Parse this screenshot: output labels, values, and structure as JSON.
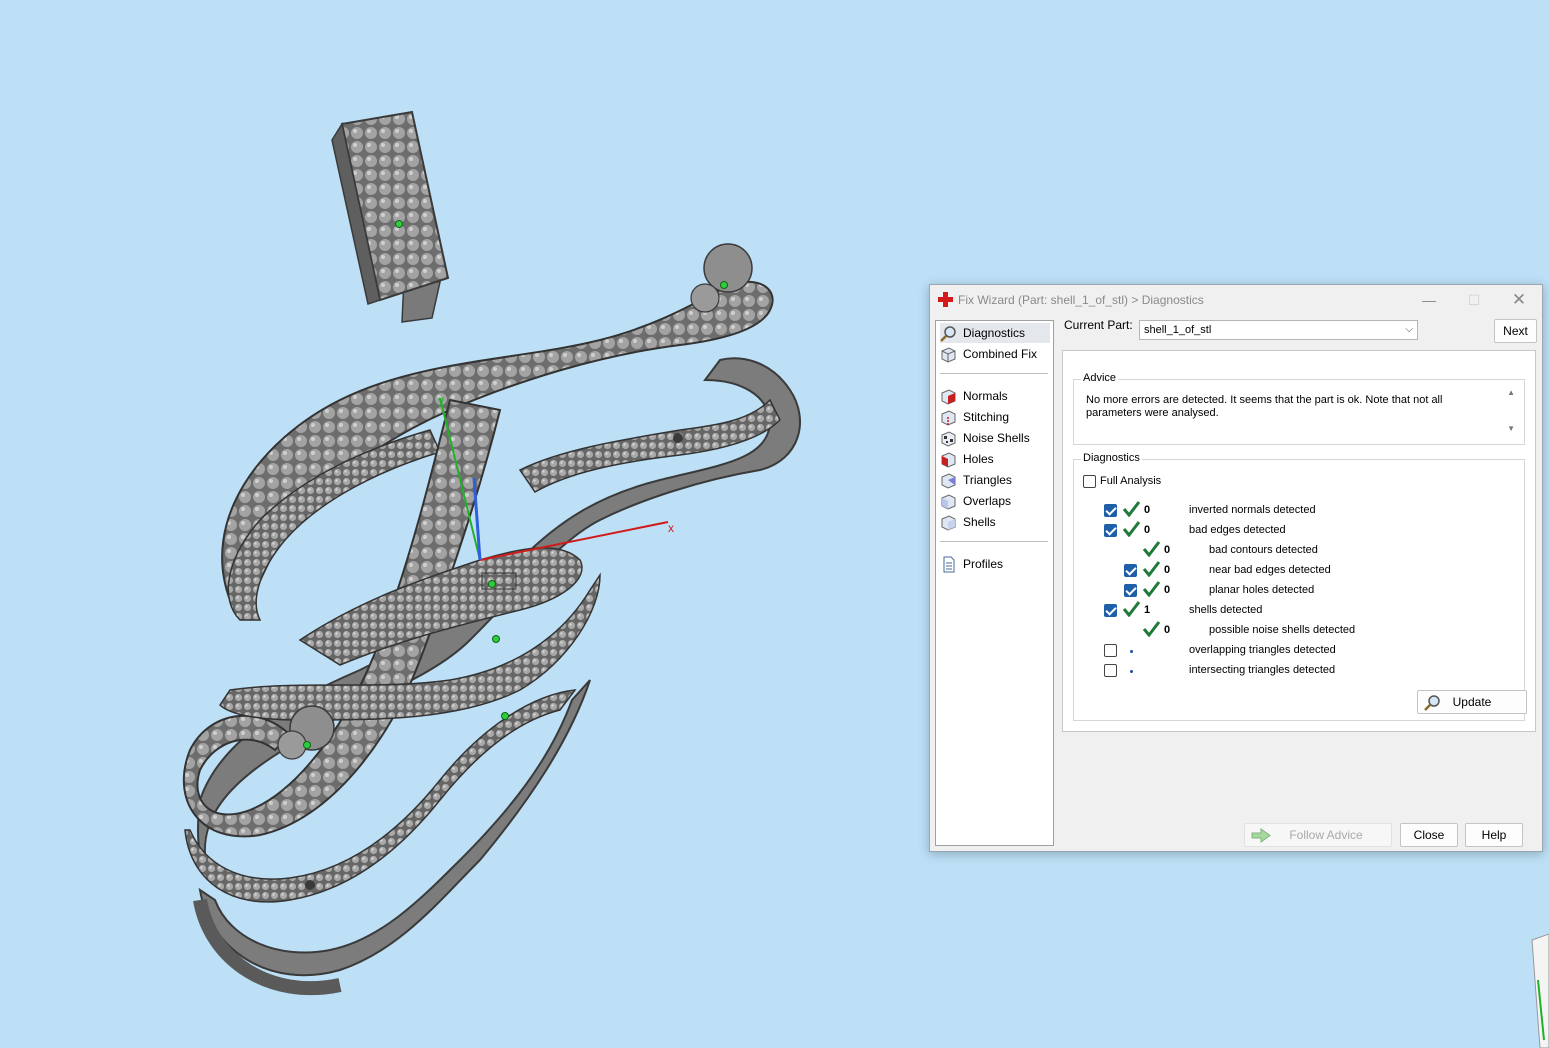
{
  "window": {
    "title": "Fix Wizard (Part: shell_1_of_stl) > Diagnostics",
    "min": "—",
    "max": "☐",
    "close": "✕"
  },
  "nav": {
    "top_items": [
      {
        "label": "Diagnostics",
        "icon": "magnifier-icon",
        "selected": true
      },
      {
        "label": "Combined Fix",
        "icon": "cube-icon"
      }
    ],
    "fix_items": [
      {
        "label": "Normals",
        "icon": "normals-cube-icon"
      },
      {
        "label": "Stitching",
        "icon": "stitching-cube-icon"
      },
      {
        "label": "Noise Shells",
        "icon": "noise-shells-icon"
      },
      {
        "label": "Holes",
        "icon": "holes-cube-icon"
      },
      {
        "label": "Triangles",
        "icon": "triangles-cube-icon"
      },
      {
        "label": "Overlaps",
        "icon": "overlaps-cube-icon"
      },
      {
        "label": "Shells",
        "icon": "shells-cube-icon"
      }
    ],
    "profiles": {
      "label": "Profiles",
      "icon": "document-icon"
    }
  },
  "current_part": {
    "label": "Current Part:",
    "value": "shell_1_of_stl",
    "next_label": "Next"
  },
  "advice": {
    "title": "Advice",
    "text": "No more errors are detected. It seems that the part is ok. Note that not all parameters were analysed."
  },
  "diagnostics": {
    "title": "Diagnostics",
    "full_analysis_label": "Full Analysis",
    "full_analysis_checked": false,
    "rows": [
      {
        "checkbox": true,
        "checked": true,
        "status": "ok",
        "count": "0",
        "label": "inverted normals detected",
        "indent": 0
      },
      {
        "checkbox": true,
        "checked": true,
        "status": "ok",
        "count": "0",
        "label": "bad edges detected",
        "indent": 0
      },
      {
        "checkbox": false,
        "checked": false,
        "status": "ok",
        "count": "0",
        "label": "bad contours detected",
        "indent": 1
      },
      {
        "checkbox": true,
        "checked": true,
        "status": "ok",
        "count": "0",
        "label": "near bad edges detected",
        "indent": 1
      },
      {
        "checkbox": true,
        "checked": true,
        "status": "ok",
        "count": "0",
        "label": "planar holes detected",
        "indent": 1
      },
      {
        "checkbox": true,
        "checked": true,
        "status": "ok",
        "count": "1",
        "label": "shells detected",
        "indent": 0
      },
      {
        "checkbox": false,
        "checked": false,
        "status": "ok",
        "count": "0",
        "label": "possible noise shells detected",
        "indent": 1
      },
      {
        "checkbox": true,
        "checked": false,
        "status": "none",
        "count": "",
        "label": "overlapping triangles detected",
        "indent": 0
      },
      {
        "checkbox": true,
        "checked": false,
        "status": "none",
        "count": "",
        "label": "intersecting triangles detected",
        "indent": 0
      }
    ],
    "update_label": "Update"
  },
  "footer": {
    "follow_advice_label": "Follow Advice",
    "close_label": "Close",
    "help_label": "Help"
  },
  "scene": {
    "axis_x_label": "x",
    "axis_y_label": "y",
    "colors": {
      "background": "#bde0f7",
      "model": "#8f8f8f",
      "x_axis": "#d11a1a",
      "y_axis": "#22b02a",
      "z_axis": "#2f5fd9",
      "check": "#1f7a3a"
    }
  }
}
